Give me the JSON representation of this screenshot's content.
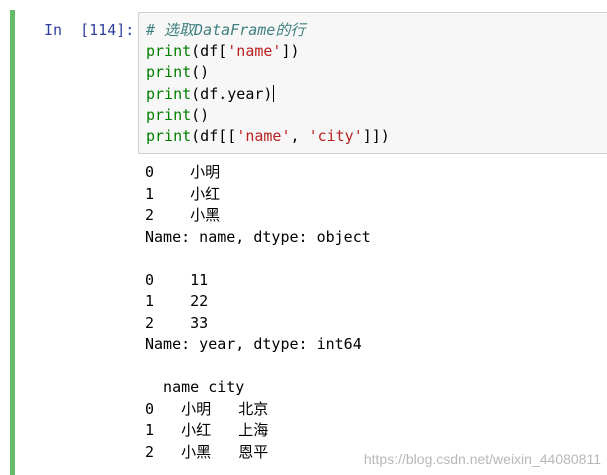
{
  "cell": {
    "prompt": "In  [114]:",
    "code_lines": [
      {
        "comment": "# 选取DataFrame的行"
      },
      {
        "func": "print",
        "a": "(df[",
        "s": "'name'",
        "b": "])"
      },
      {
        "func": "print",
        "a": "()"
      },
      {
        "func": "print",
        "a": "(df.year)"
      },
      {
        "func": "print",
        "a": "()"
      },
      {
        "func": "print",
        "a": "(df[[",
        "s1": "'name'",
        "sep": ", ",
        "s2": "'city'",
        "b": "]])"
      }
    ],
    "output_lines": [
      "0    小明",
      "1    小红",
      "2    小黑",
      "Name: name, dtype: object",
      "",
      "0    11",
      "1    22",
      "2    33",
      "Name: year, dtype: int64",
      "",
      "  name city",
      "0   小明   北京",
      "1   小红   上海",
      "2   小黑   恩平"
    ]
  },
  "watermark": "https://blog.csdn.net/weixin_44080811",
  "colors": {
    "selection_bar": "#66bb6a",
    "prompt": "#303f9f",
    "keyword": "#008000",
    "string": "#ba2121",
    "comment": "#408080"
  }
}
